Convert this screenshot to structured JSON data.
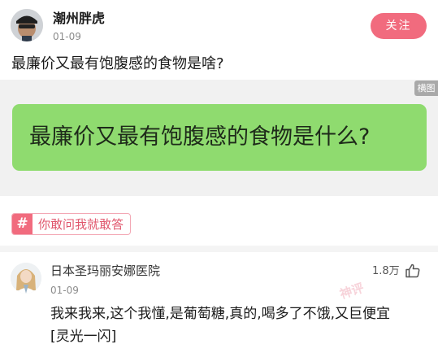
{
  "post": {
    "author_name": "潮州胖虎",
    "date": "01-09",
    "follow_label": "关注",
    "question": "最廉价又最有饱腹感的食物是啥?"
  },
  "image": {
    "badge": "横图",
    "bubble_text": "最廉价又最有饱腹感的食物是什么?",
    "bubble_color": "#8fdb6f"
  },
  "topic": {
    "icon": "#",
    "label": "你敢问我就敢答"
  },
  "comment": {
    "author_name": "日本圣玛丽安娜医院",
    "date": "01-09",
    "likes": "1.8万",
    "text": "我来我来,这个我懂,是葡萄糖,真的,喝多了不饿,又巨便宜[灵光一闪]",
    "stamp": "神评"
  },
  "colors": {
    "accent": "#f16b7e",
    "topic_text": "#e0566c"
  }
}
